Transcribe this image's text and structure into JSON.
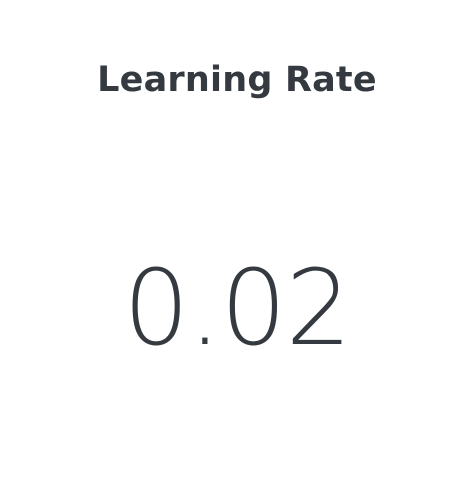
{
  "metric": {
    "title": "Learning Rate",
    "value": "0.02"
  },
  "colors": {
    "text": "#343a40",
    "background": "#ffffff"
  }
}
